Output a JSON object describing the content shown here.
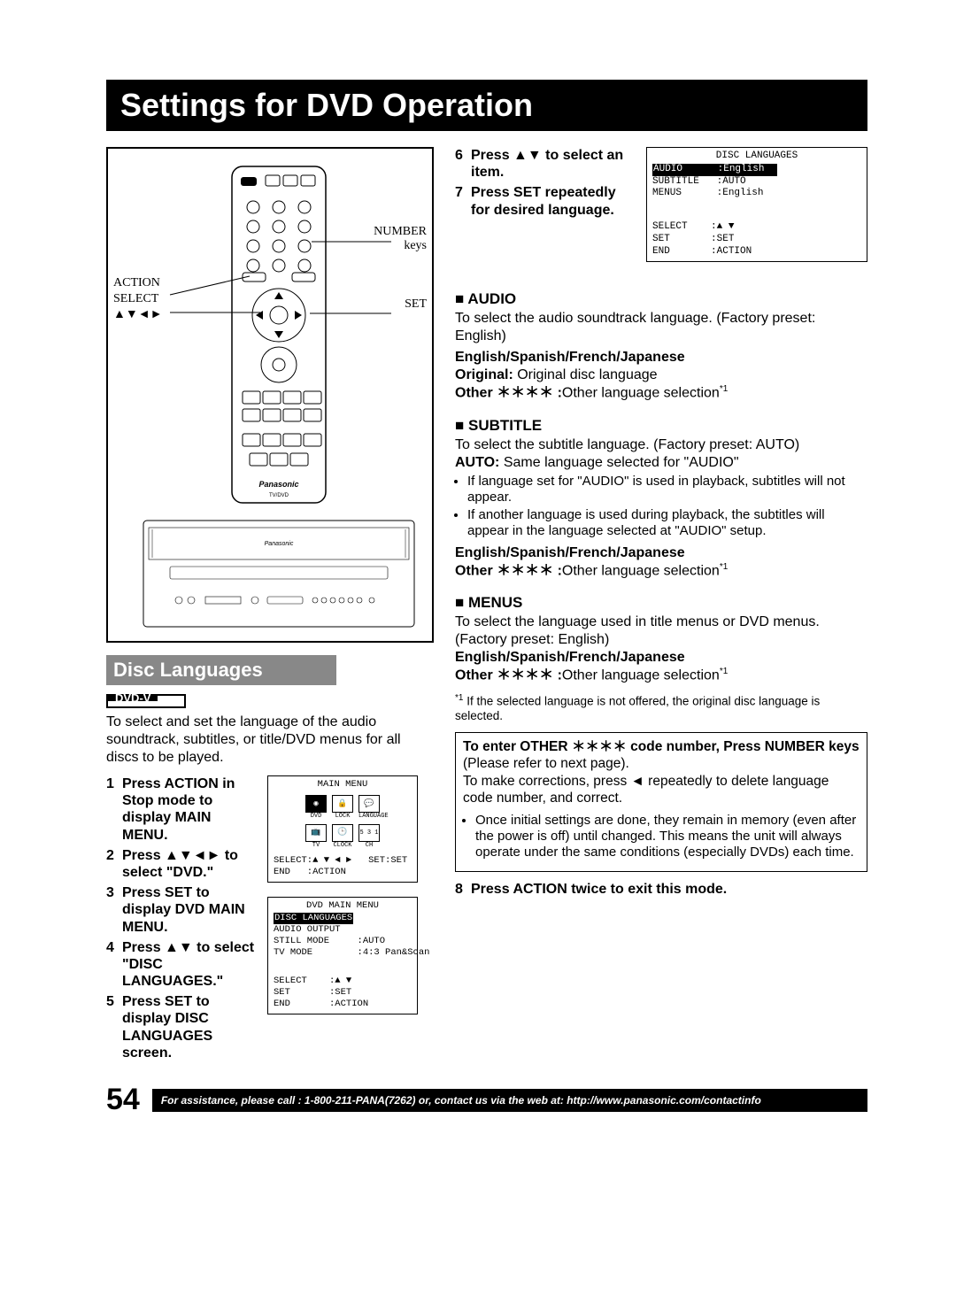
{
  "title": "Settings for DVD Operation",
  "pageNumber": "54",
  "footer": "For assistance, please call : 1-800-211-PANA(7262) or, contact us via the web at: http://www.panasonic.com/contactinfo",
  "remote": {
    "callouts": {
      "action": "ACTION",
      "select": "SELECT",
      "arrows": "▲▼◄►",
      "number": "NUMBER",
      "keys": "keys",
      "set": "SET"
    }
  },
  "sectionTitle": "Disc Languages",
  "badge": "DVD-V",
  "intro": "To select and set the language of the audio soundtrack, subtitles, or title/DVD menus for all discs to be played.",
  "leftSteps": {
    "s1": "Press ACTION in Stop mode to display MAIN MENU.",
    "s2p1": "Press ",
    "s2arrows": "▲▼◄►",
    "s2p2": " to select \"DVD.\"",
    "s3": "Press SET to display DVD MAIN MENU.",
    "s4p1": "Press ",
    "s4arrows": "▲▼",
    "s4p2": " to select \"DISC LANGUAGES.\"",
    "s5": "Press SET to display DISC LANGUAGES screen."
  },
  "rightTopSteps": {
    "s6p1": "Press ",
    "s6arrows": "▲▼",
    "s6p2": " to select an item.",
    "s7": "Press SET repeatedly for desired language."
  },
  "osd": {
    "main": {
      "title": "MAIN MENU",
      "labels": {
        "dvd": "DVD",
        "lock": "LOCK",
        "language": "LANGUAGE",
        "tv": "TV",
        "clock": "CLOCK",
        "ch": "CH",
        "chVal": "5 3 1"
      },
      "footer1": "SELECT:▲ ▼ ◄ ►   SET:SET",
      "footer2": "END   :ACTION"
    },
    "dvdMain": {
      "title": "DVD MAIN MENU",
      "hl": "DISC LANGUAGES",
      "r1": "AUDIO OUTPUT",
      "r2": "STILL MODE     :AUTO",
      "r3": "TV MODE        :4:3 Pan&Scan",
      "f1": "SELECT    :▲ ▼",
      "f2": "SET       :SET",
      "f3": "END       :ACTION"
    },
    "discLang": {
      "title": "DISC LANGUAGES",
      "hlLabel": "AUDIO",
      "hlVal": ":English",
      "r2": "SUBTITLE   :AUTO",
      "r3": "MENUS      :English",
      "f1": "SELECT    :▲ ▼",
      "f2": "SET       :SET",
      "f3": "END       :ACTION"
    }
  },
  "audio": {
    "heading": "AUDIO",
    "desc": "To select the audio soundtrack language. (Factory preset: English)",
    "langs": "English/Spanish/French/Japanese",
    "origLabel": "Original:",
    "origDesc": " Original disc language",
    "otherLabel": "Other ＊＊＊＊ :",
    "otherDesc": "Other language selection"
  },
  "subtitle": {
    "heading": "SUBTITLE",
    "desc": "To select the subtitle language. (Factory preset: AUTO)",
    "autoLabel": "AUTO:",
    "autoDesc": " Same language selected for \"AUDIO\"",
    "b1": "If language set for \"AUDIO\" is used in playback, subtitles will not appear.",
    "b2": "If another language is used during playback, the subtitles will appear in the language selected at \"AUDIO\" setup.",
    "langs": "English/Spanish/French/Japanese",
    "otherLabel": "Other ＊＊＊＊ :",
    "otherDesc": "Other language selection"
  },
  "menus": {
    "heading": "MENUS",
    "desc": "To select the language used in title menus or DVD menus. (Factory preset: English)",
    "langs": "English/Spanish/French/Japanese",
    "otherLabel": "Other ＊＊＊＊ :",
    "otherDesc": "Other language selection"
  },
  "footnote": "If the selected language is not offered, the original disc language is selected.",
  "enterBox": {
    "l1a": "To enter OTHER ＊＊＊＊ code number, Press NUMBER keys",
    "l1b": " (Please refer to next page).",
    "l2a": "To make corrections, press ",
    "l2arrow": "◄",
    "l2b": " repeatedly to delete language code number, and correct.",
    "b1": "Once initial settings are done, they remain in memory (even after the power is off) until changed. This means the unit will always operate under the same conditions (especially DVDs) each time."
  },
  "step8": "Press ACTION twice to exit this mode."
}
